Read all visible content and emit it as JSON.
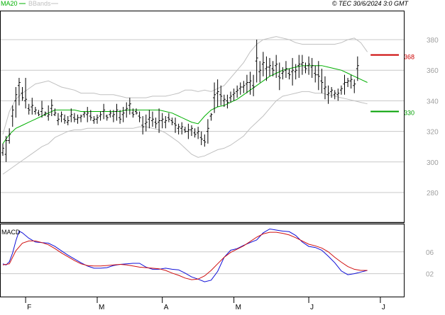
{
  "legend": {
    "ma_label": "MA20",
    "bb_label": "BBands"
  },
  "copyright": "© TEC 30/6/2024 3:0 GMT",
  "colors": {
    "candles": "#000000",
    "ma20": "#00b000",
    "bbands": "#c0c0c0",
    "macd": "#1010d8",
    "signal": "#d01010",
    "grid": "#c8c8c8",
    "resistance": "#cc0000",
    "support": "#00a000",
    "axis_text": "#a0a0a0"
  },
  "chart_data": [
    {
      "type": "candlestick",
      "title": "",
      "y_ticks": [
        "280",
        "300",
        "320",
        "340",
        "360",
        "380"
      ],
      "ylim": [
        268,
        392
      ],
      "x_ticks": [
        "F",
        "M",
        "A",
        "M",
        "J",
        "J"
      ],
      "x_tick_positions": [
        7,
        29,
        49,
        71,
        94,
        116
      ],
      "n_sessions": 112,
      "levels": [
        {
          "name": "resistance",
          "label": "368",
          "value": 370,
          "start": 113,
          "color": "#cc0000"
        },
        {
          "name": "support",
          "label": "330",
          "value": 333,
          "start": 113,
          "color": "#00a000"
        }
      ],
      "series": [
        {
          "name": "MA20",
          "type": "line",
          "color": "#00b000",
          "x": [
            0,
            2,
            4,
            6,
            8,
            10,
            12,
            14,
            16,
            18,
            20,
            22,
            24,
            26,
            28,
            30,
            32,
            34,
            36,
            38,
            40,
            42,
            44,
            46,
            48,
            50,
            52,
            54,
            56,
            58,
            60,
            62,
            64,
            66,
            68,
            70,
            72,
            74,
            76,
            78,
            80,
            82,
            84,
            86,
            88,
            90,
            92,
            94,
            96,
            98,
            100,
            102,
            104,
            106,
            108,
            110,
            112
          ],
          "y": [
            312,
            318,
            322,
            324,
            326,
            328,
            330,
            332,
            334,
            334,
            334,
            334,
            333,
            333,
            333,
            333,
            333,
            333,
            333,
            334,
            334,
            334,
            334,
            334,
            334,
            333,
            332,
            330,
            328,
            326,
            325,
            330,
            334,
            336,
            337,
            339,
            341,
            344,
            347,
            350,
            353,
            356,
            358,
            360,
            361,
            362,
            363,
            363,
            363,
            363,
            362,
            361,
            360,
            358,
            356,
            354,
            352
          ]
        },
        {
          "name": "BBands",
          "type": "line",
          "color": "#c0c0c0",
          "x": [
            0,
            2,
            4,
            6,
            8,
            10,
            12,
            14,
            16,
            18,
            20,
            22,
            24,
            26,
            28,
            30,
            32,
            34,
            36,
            38,
            40,
            42,
            44,
            46,
            48,
            50,
            52,
            54,
            56,
            58,
            60,
            62,
            64,
            66,
            68,
            70,
            72,
            74,
            76,
            78,
            80,
            82,
            84,
            86,
            88,
            90,
            92,
            94,
            96,
            98,
            100,
            102,
            104,
            106,
            108,
            110,
            112
          ],
          "y": [
            318,
            333,
            341,
            345,
            348,
            351,
            352,
            353,
            351,
            349,
            348,
            347,
            345,
            345,
            345,
            344,
            344,
            344,
            343,
            342,
            342,
            342,
            342,
            343,
            343,
            343,
            344,
            345,
            347,
            347,
            346,
            347,
            346,
            348,
            350,
            355,
            360,
            365,
            372,
            377,
            380,
            381,
            382,
            381,
            380,
            378,
            377,
            377,
            377,
            377,
            377,
            377,
            378,
            380,
            381,
            378,
            372
          ]
        },
        {
          "name": "BBands",
          "type": "line",
          "color": "#c0c0c0",
          "x": [
            0,
            2,
            4,
            6,
            8,
            10,
            12,
            14,
            16,
            18,
            20,
            22,
            24,
            26,
            28,
            30,
            32,
            34,
            36,
            38,
            40,
            42,
            44,
            46,
            48,
            50,
            52,
            54,
            56,
            58,
            60,
            62,
            64,
            66,
            68,
            70,
            72,
            74,
            76,
            78,
            80,
            82,
            84,
            86,
            88,
            90,
            92,
            94,
            96,
            98,
            100,
            102,
            104,
            106,
            108,
            110,
            112
          ],
          "y": [
            292,
            295,
            298,
            301,
            304,
            307,
            310,
            312,
            316,
            318,
            320,
            321,
            321,
            322,
            322,
            322,
            322,
            322,
            322,
            322,
            322,
            323,
            323,
            322,
            321,
            319,
            316,
            313,
            309,
            305,
            303,
            304,
            306,
            308,
            309,
            311,
            314,
            317,
            322,
            326,
            330,
            335,
            340,
            343,
            344,
            345,
            346,
            346,
            345,
            345,
            344,
            343,
            342,
            341,
            340,
            339,
            338
          ]
        }
      ],
      "candles": {
        "high": [
          312,
          317,
          322,
          337,
          349,
          355,
          349,
          355,
          338,
          342,
          336,
          334,
          340,
          333,
          337,
          341,
          335,
          332,
          333,
          331,
          330,
          335,
          332,
          331,
          331,
          333,
          336,
          334,
          330,
          331,
          333,
          338,
          331,
          334,
          334,
          338,
          334,
          336,
          339,
          342,
          335,
          335,
          333,
          330,
          331,
          334,
          333,
          329,
          335,
          332,
          330,
          332,
          329,
          329,
          325,
          326,
          323,
          325,
          324,
          322,
          323,
          320,
          318,
          328,
          332,
          352,
          354,
          350,
          344,
          344,
          346,
          348,
          350,
          352,
          353,
          357,
          359,
          357,
          380,
          366,
          372,
          369,
          368,
          366,
          370,
          365,
          362,
          366,
          361,
          368,
          364,
          370,
          370,
          365,
          369,
          368,
          363,
          366,
          361,
          356,
          350,
          349,
          347,
          348,
          350,
          357,
          355,
          357,
          354,
          369
        ],
        "low": [
          304,
          300,
          312,
          323,
          329,
          337,
          340,
          335,
          331,
          331,
          331,
          330,
          329,
          330,
          327,
          330,
          330,
          324,
          326,
          325,
          324,
          326,
          326,
          325,
          326,
          329,
          326,
          327,
          325,
          325,
          327,
          328,
          327,
          329,
          326,
          327,
          325,
          326,
          329,
          331,
          329,
          331,
          326,
          318,
          320,
          322,
          323,
          322,
          319,
          322,
          322,
          326,
          324,
          319,
          318,
          318,
          319,
          315,
          317,
          316,
          315,
          311,
          310,
          312,
          327,
          332,
          336,
          337,
          336,
          335,
          339,
          340,
          342,
          344,
          345,
          345,
          344,
          343,
          352,
          352,
          356,
          353,
          356,
          356,
          355,
          347,
          354,
          355,
          354,
          350,
          354,
          355,
          357,
          358,
          357,
          355,
          352,
          347,
          345,
          341,
          338,
          342,
          341,
          340,
          344,
          344,
          349,
          348,
          345,
          353
        ],
        "open": [
          306,
          305,
          314,
          330,
          340,
          350,
          345,
          340,
          335,
          336,
          333,
          332,
          333,
          331,
          330,
          335,
          331,
          327,
          330,
          328,
          326,
          330,
          329,
          328,
          329,
          331,
          331,
          330,
          327,
          328,
          330,
          333,
          330,
          331,
          330,
          333,
          329,
          331,
          334,
          337,
          332,
          333,
          330,
          324,
          325,
          328,
          327,
          326,
          326,
          327,
          326,
          329,
          327,
          325,
          322,
          322,
          321,
          320,
          321,
          319,
          319,
          316,
          314,
          320,
          330,
          342,
          345,
          344,
          340,
          340,
          342,
          344,
          346,
          348,
          349,
          351,
          352,
          350,
          366,
          359,
          364,
          361,
          362,
          361,
          363,
          356,
          358,
          360,
          358,
          359,
          359,
          363,
          364,
          362,
          363,
          362,
          358,
          357,
          353,
          348,
          344,
          346,
          344,
          344,
          347,
          351,
          352,
          353,
          350,
          361
        ],
        "close": [
          309,
          314,
          318,
          334,
          344,
          352,
          342,
          341,
          334,
          337,
          334,
          331,
          335,
          332,
          331,
          337,
          332,
          328,
          331,
          327,
          327,
          331,
          328,
          329,
          330,
          332,
          332,
          329,
          328,
          329,
          331,
          334,
          329,
          332,
          331,
          334,
          328,
          332,
          335,
          338,
          331,
          332,
          329,
          323,
          326,
          329,
          328,
          325,
          327,
          328,
          327,
          328,
          326,
          324,
          323,
          323,
          320,
          321,
          322,
          318,
          320,
          315,
          313,
          322,
          331,
          344,
          346,
          343,
          341,
          339,
          343,
          345,
          347,
          349,
          350,
          352,
          353,
          349,
          368,
          360,
          365,
          362,
          363,
          360,
          364,
          355,
          359,
          361,
          357,
          360,
          360,
          364,
          365,
          361,
          364,
          363,
          357,
          356,
          352,
          349,
          345,
          347,
          345,
          345,
          348,
          352,
          353,
          354,
          351,
          363
        ]
      }
    },
    {
      "type": "line",
      "title": "MACD",
      "y_ticks": [
        "02",
        "06"
      ],
      "ylim": [
        -0.1,
        1.1
      ],
      "x_ticks": [
        "F",
        "M",
        "A",
        "M",
        "J",
        "J"
      ],
      "series": [
        {
          "name": "MACD",
          "color": "#1010d8",
          "x": [
            0,
            1,
            2,
            3,
            4,
            5,
            6,
            8,
            10,
            12,
            14,
            16,
            18,
            20,
            22,
            24,
            26,
            28,
            30,
            32,
            34,
            36,
            38,
            40,
            42,
            44,
            46,
            48,
            50,
            52,
            54,
            56,
            58,
            60,
            62,
            64,
            66,
            68,
            70,
            72,
            74,
            76,
            78,
            80,
            82,
            84,
            86,
            88,
            90,
            92,
            94,
            96,
            98,
            100,
            102,
            104,
            106,
            108,
            110,
            112
          ],
          "y": [
            0.38,
            0.36,
            0.42,
            0.58,
            0.8,
            0.98,
            0.95,
            0.85,
            0.78,
            0.77,
            0.76,
            0.7,
            0.62,
            0.54,
            0.47,
            0.4,
            0.34,
            0.3,
            0.3,
            0.31,
            0.35,
            0.37,
            0.38,
            0.39,
            0.39,
            0.32,
            0.28,
            0.28,
            0.3,
            0.28,
            0.27,
            0.21,
            0.14,
            0.1,
            0.05,
            0.08,
            0.24,
            0.5,
            0.63,
            0.66,
            0.72,
            0.77,
            0.82,
            0.95,
            1.02,
            1.0,
            0.98,
            0.97,
            0.9,
            0.78,
            0.7,
            0.68,
            0.63,
            0.52,
            0.4,
            0.25,
            0.18,
            0.2,
            0.23,
            0.26
          ]
        },
        {
          "name": "Signal",
          "color": "#d01010",
          "x": [
            0,
            2,
            4,
            6,
            8,
            10,
            12,
            14,
            16,
            18,
            20,
            22,
            24,
            26,
            28,
            30,
            32,
            34,
            36,
            38,
            40,
            42,
            44,
            46,
            48,
            50,
            52,
            54,
            56,
            58,
            60,
            62,
            64,
            66,
            68,
            70,
            72,
            74,
            76,
            78,
            80,
            82,
            84,
            86,
            88,
            90,
            92,
            94,
            96,
            98,
            100,
            102,
            104,
            106,
            108,
            110,
            112
          ],
          "y": [
            0.36,
            0.38,
            0.62,
            0.76,
            0.8,
            0.8,
            0.77,
            0.73,
            0.66,
            0.58,
            0.51,
            0.44,
            0.38,
            0.35,
            0.34,
            0.34,
            0.35,
            0.36,
            0.37,
            0.36,
            0.34,
            0.32,
            0.31,
            0.3,
            0.29,
            0.26,
            0.21,
            0.17,
            0.12,
            0.09,
            0.1,
            0.16,
            0.26,
            0.38,
            0.5,
            0.59,
            0.65,
            0.71,
            0.79,
            0.87,
            0.93,
            0.96,
            0.96,
            0.94,
            0.91,
            0.86,
            0.8,
            0.74,
            0.71,
            0.67,
            0.6,
            0.5,
            0.41,
            0.33,
            0.28,
            0.26,
            0.26
          ]
        }
      ]
    }
  ]
}
